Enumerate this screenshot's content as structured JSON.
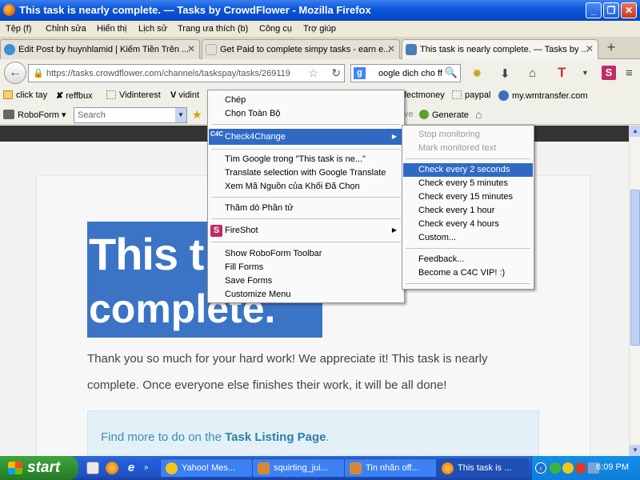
{
  "window": {
    "title": "This task is nearly complete. — Tasks by CrowdFlower - Mozilla Firefox"
  },
  "menubar": [
    "Tệp (f)",
    "Chỉnh sửa",
    "Hiển thị",
    "Lịch sử",
    "Trang ưa thích (b)",
    "Công cụ",
    "Trợ giúp"
  ],
  "tabs": [
    {
      "label": "Edit Post by huynhlamid | Kiếm Tiền Trên ..."
    },
    {
      "label": "Get Paid to complete simpy tasks - earn e..."
    },
    {
      "label": "This task is nearly complete. — Tasks by ..."
    }
  ],
  "nav": {
    "url": "https://tasks.crowdflower.com/channels/taskspay/tasks/269119",
    "search_value": "oogle dich cho ff"
  },
  "bookmarks": [
    "click tay",
    "reffbux",
    "Vidinterest",
    "vidint",
    "fectmoney",
    "paypal",
    "my.wmtransfer.com"
  ],
  "roboform": {
    "logo": "RoboForm",
    "search_placeholder": "Search",
    "truncated": "ve",
    "generate": "Generate"
  },
  "page": {
    "heading_line1": "This t",
    "heading_line2": "complete.",
    "body": "Thank you so much for your hard work! We appreciate it! This task is nearly complete. Once everyone else finishes their work, it will be all done!",
    "info_prefix": "Find more to do on the ",
    "info_link": "Task Listing Page",
    "info_suffix": "."
  },
  "context_menu": {
    "copy": "Chép",
    "select_all": "Chọn Toàn Bộ",
    "check4change": "Check4Change",
    "google_search": "Tìm Google trong \"This task is ne...\"",
    "translate": "Translate selection with Google Translate",
    "view_source": "Xem Mã Nguồn của Khối Đã Chọn",
    "inspect": "Thăm dò Phần tử",
    "fireshot": "FireShot",
    "show_roboform": "Show RoboForm Toolbar",
    "fill_forms": "Fill Forms",
    "save_forms": "Save Forms",
    "customize_menu": "Customize Menu"
  },
  "submenu": {
    "stop_monitoring": "Stop monitoring",
    "mark_text": "Mark monitored text",
    "every_2s": "Check every 2 seconds",
    "every_5m": "Check every 5 minutes",
    "every_15m": "Check every 15 minutes",
    "every_1h": "Check every 1 hour",
    "every_4h": "Check every 4 hours",
    "custom": "Custom...",
    "feedback": "Feedback...",
    "vip": "Become a C4C VIP! :)"
  },
  "taskbar": {
    "start": "start",
    "buttons": [
      "Yahoo! Mes...",
      "squirting_jui...",
      "Tin nhắn off...",
      "This task is ..."
    ],
    "clock": "6:09 PM"
  },
  "colors": {
    "highlight": "#316ac5",
    "selection": "#3b74c5",
    "link": "#2d7fa8"
  }
}
